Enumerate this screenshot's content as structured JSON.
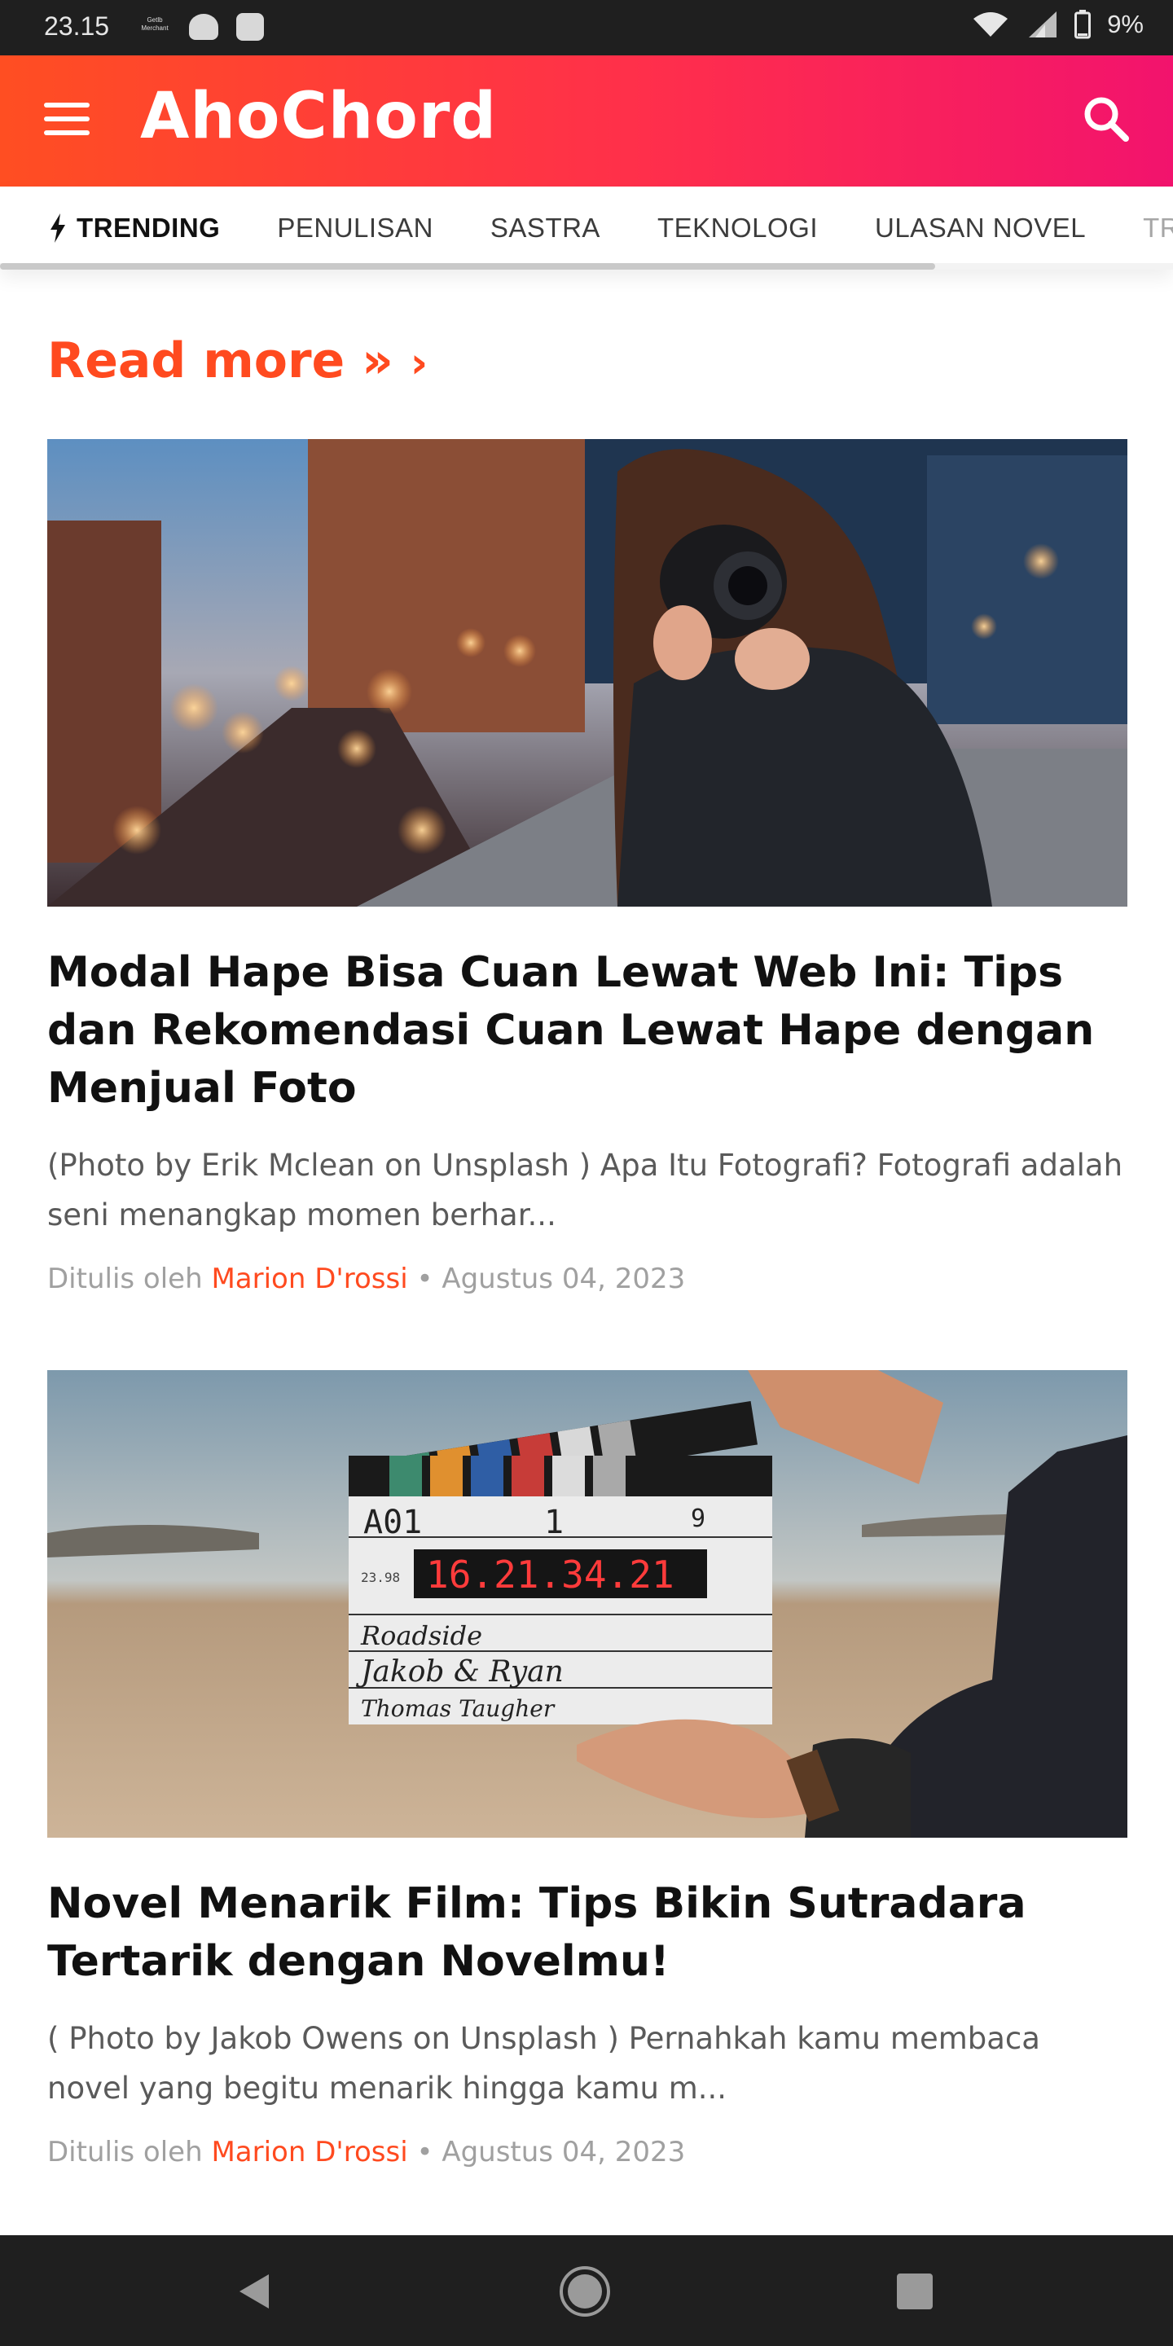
{
  "status": {
    "time": "23.15",
    "notif_label": "Getlb Merchant",
    "battery": "9%"
  },
  "header": {
    "logo": "AhoChord",
    "menu_icon": "hamburger-menu-icon",
    "search_icon": "search-icon"
  },
  "nav": {
    "trending": "TRENDING",
    "items": [
      "PENULISAN",
      "SASTRA",
      "TEKNOLOGI",
      "ULASAN NOVEL",
      "TRA"
    ]
  },
  "readmore": {
    "label": "Read more »",
    "chev": "›"
  },
  "posts": [
    {
      "title": "Modal Hape Bisa Cuan Lewat Web Ini: Tips dan Rekomendasi Cuan Lewat Hape dengan Menjual Foto",
      "excerpt": "(Photo by Erik Mclean on Unsplash ) Apa Itu Fotografi? Fotografi adalah seni menangkap momen berhar...",
      "by_label": "Ditulis oleh",
      "author": "Marion D'rossi",
      "sep": "•",
      "date": "Agustus 04, 2023"
    },
    {
      "title": "Novel Menarik Film: Tips Bikin Sutradara Tertarik dengan Novelmu!",
      "excerpt": "( Photo by Jakob Owens on Unsplash ) Pernahkah kamu membaca novel yang begitu menarik hingga kamu m...",
      "by_label": "Ditulis oleh",
      "author": "Marion D'rossi",
      "sep": "•",
      "date": "Agustus 04, 2023",
      "clapper": {
        "scene": "A01",
        "take": "1",
        "roll": "9",
        "timecode": "16.21.34.21",
        "fps": "23.98",
        "line1": "Roadside",
        "line2": "Jakob & Ryan",
        "line3": "Thomas Taugher"
      }
    }
  ],
  "colors": {
    "accent": "#ff4a1f",
    "header_start": "#ff4e22",
    "header_end": "#f2136d"
  }
}
